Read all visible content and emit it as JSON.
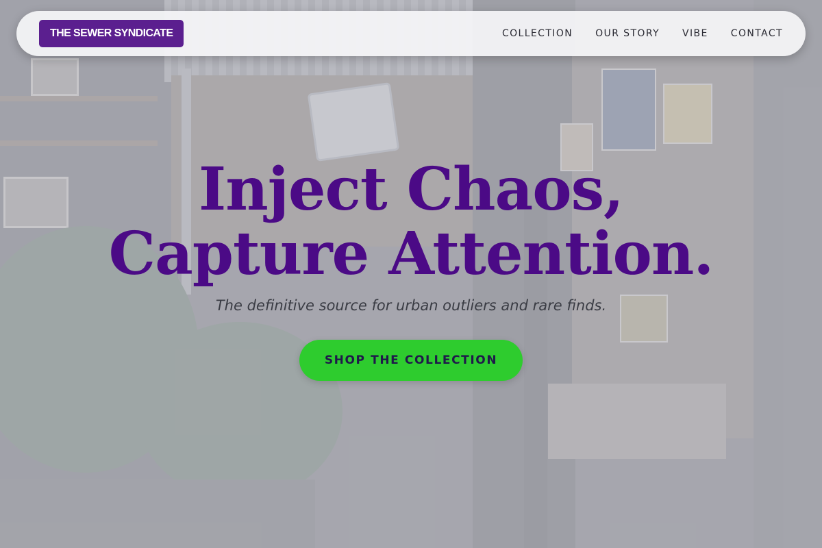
{
  "brand": {
    "name": "THE SEWER SYNDICATE",
    "color": "#5b1f8f"
  },
  "nav": {
    "items": [
      {
        "label": "COLLECTION"
      },
      {
        "label": "OUR STORY"
      },
      {
        "label": "VIBE"
      },
      {
        "label": "CONTACT"
      }
    ]
  },
  "hero": {
    "headline_line1": "Inject Chaos,",
    "headline_line2": "Capture Attention.",
    "subheadline": "The definitive source for urban outliers and rare finds.",
    "cta_label": "SHOP THE COLLECTION",
    "headline_color": "#4b0a86",
    "cta_color": "#2ecc2e"
  }
}
